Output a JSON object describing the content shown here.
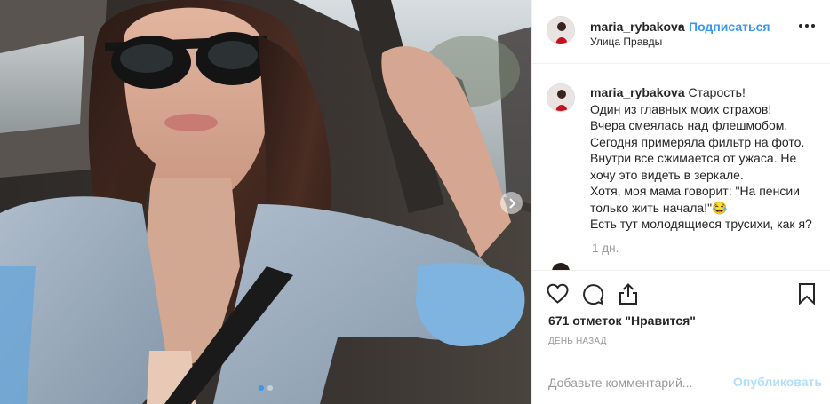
{
  "post": {
    "username": "maria_rybakova",
    "follow_label": "Подписаться",
    "bullet": "•",
    "location": "Улица Правды"
  },
  "caption": {
    "username": "maria_rybakova",
    "lines": [
      "Старость!",
      "Один из главных моих страхов!",
      "Вчера смеялась над флешмобом.",
      "Сегодня примеряла фильтр на фото.",
      "Внутри все сжимается от ужаса. Не",
      "хочу это видеть в зеркале.",
      "Хотя, моя мама говорит: \"На пенсии",
      "только жить начала!\"😂",
      "Есть тут молодящиеся трусихи, как я?"
    ],
    "time": "1 дн."
  },
  "actions": {
    "likes": "671 отметок \"Нравится\"",
    "date": "День назад"
  },
  "comment_box": {
    "placeholder": "Добавьте комментарий...",
    "publish_label": "Опубликовать"
  },
  "carousel": {
    "slide_count": 2,
    "active_index": 0
  },
  "colors": {
    "accent": "#3897f0",
    "publish_disabled": "#b2dffc",
    "muted": "#999999",
    "text": "#262626"
  },
  "icons": [
    "chevron-right-icon",
    "more-options-icon",
    "heart-icon",
    "comment-icon",
    "share-icon",
    "bookmark-icon"
  ]
}
